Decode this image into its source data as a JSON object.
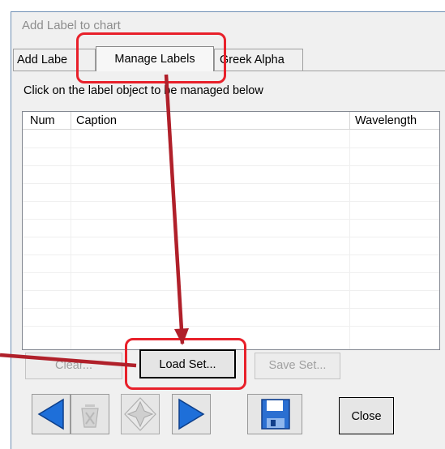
{
  "window": {
    "title": "Add Label to chart"
  },
  "tabs": [
    {
      "label": "Add Labe"
    },
    {
      "label": "Manage Labels"
    },
    {
      "label": "Greek Alpha"
    }
  ],
  "panel": {
    "instruction": "Click on the label object to be managed below"
  },
  "table": {
    "columns": [
      "Num",
      "Caption",
      "Wavelength"
    ],
    "rows": []
  },
  "buttons": {
    "clear": "Clear...",
    "load": "Load Set...",
    "save": "Save Set...",
    "close": "Close"
  },
  "icons": {
    "prev": "left-arrow-icon",
    "delete": "trash-icon",
    "move": "move-icon",
    "next": "right-arrow-icon",
    "save": "floppy-disk-icon"
  },
  "colors": {
    "highlight": "#e8202a",
    "annotation_arrow": "#b0202a",
    "nav_arrow": "#1e6fd9"
  }
}
